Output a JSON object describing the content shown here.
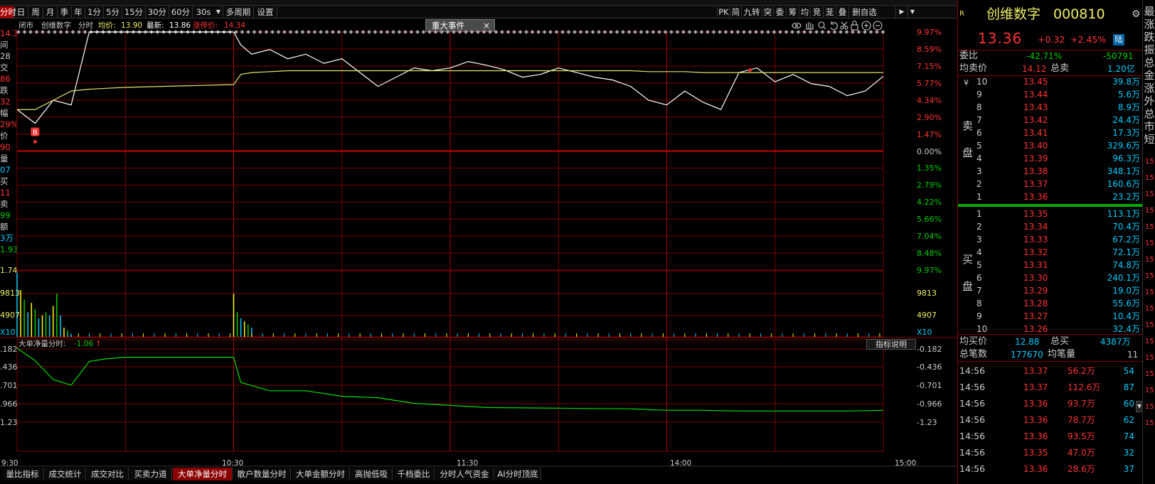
{
  "toolbar": {
    "tabs": [
      "分时",
      "日",
      "周",
      "月",
      "季",
      "年",
      "1分",
      "5分",
      "15分",
      "30分",
      "60分",
      "30s",
      "多周期",
      "设置"
    ],
    "dropdown_icon": "caret-down-icon",
    "right_tabs": [
      "PK",
      "简",
      "九转",
      "突",
      "委",
      "筹",
      "均",
      "竞",
      "茏",
      "叠",
      "删自选"
    ]
  },
  "header": {
    "status": "闭市",
    "stock_name": "创维数字",
    "mode": "分时",
    "avg_label": "均价:",
    "avg_value": "13.90",
    "latest_label": "最新:",
    "latest_value": "13.86",
    "limit_label": "涨停价:",
    "limit_value": "14.34",
    "event_button": "重大事件",
    "close_glyph": "×"
  },
  "tool_icons": [
    "eye-icon",
    "hand-icon",
    "zoom-icon",
    "undo-icon",
    "scissors-icon",
    "lock-icon",
    "zoom-in-icon",
    "zoom-out-icon"
  ],
  "left_panel": {
    "rows": [
      {
        "t": "14.34",
        "c": "#f33"
      },
      {
        "t": "间",
        "c": "#ccc"
      },
      {
        "t": "28",
        "c": "#ccc"
      },
      {
        "t": "交",
        "c": "#ccc"
      },
      {
        "t": "86",
        "c": "#f33"
      },
      {
        "t": "跌",
        "c": "#ccc"
      },
      {
        "t": "32",
        "c": "#f33"
      },
      {
        "t": "幅",
        "c": "#ccc"
      },
      {
        "t": "29%",
        "c": "#f33"
      },
      {
        "t": "价",
        "c": "#ccc"
      },
      {
        "t": "90",
        "c": "#f33"
      },
      {
        "t": "量",
        "c": "#ccc"
      },
      {
        "t": "07",
        "c": "#0cf"
      },
      {
        "t": "买",
        "c": "#ccc"
      },
      {
        "t": "11",
        "c": "#f33"
      },
      {
        "t": "卖",
        "c": "#ccc"
      },
      {
        "t": "99",
        "c": "#0c0"
      },
      {
        "t": "额",
        "c": "#ccc"
      },
      {
        "t": "3万",
        "c": "#0cf"
      },
      {
        "t": "1.93",
        "c": "#0c0"
      }
    ]
  },
  "price_axis": {
    "right_labels": [
      {
        "t": "9.97%",
        "c": "#f33"
      },
      {
        "t": "8.59%",
        "c": "#f33"
      },
      {
        "t": "7.15%",
        "c": "#f33"
      },
      {
        "t": "5.77%",
        "c": "#f33"
      },
      {
        "t": "4.34%",
        "c": "#f33"
      },
      {
        "t": "2.90%",
        "c": "#f33"
      },
      {
        "t": "1.47%",
        "c": "#f33"
      },
      {
        "t": "0.00%",
        "c": "#ccc"
      },
      {
        "t": "1.35%",
        "c": "#0c0"
      },
      {
        "t": "2.79%",
        "c": "#0c0"
      },
      {
        "t": "4.22%",
        "c": "#0c0"
      },
      {
        "t": "5.66%",
        "c": "#0c0"
      },
      {
        "t": "7.04%",
        "c": "#0c0"
      },
      {
        "t": "8.48%",
        "c": "#0c0"
      },
      {
        "t": "9.97%",
        "c": "#0c0"
      }
    ]
  },
  "volume_axis": {
    "labels": [
      "1.74",
      "9813",
      "4907",
      "X10"
    ],
    "right_labels": [
      "9813",
      "4907",
      "X10"
    ]
  },
  "indicator": {
    "title": "大单净量分时:",
    "value": "-1.06",
    "arrow": "↑",
    "help_button": "指标说明",
    "left_labels": [
      ".182",
      ".436",
      ".701",
      ".966",
      "1.23"
    ],
    "right_labels": [
      "-0.182",
      "-0.436",
      "-0.701",
      "-0.966",
      "-1.23"
    ]
  },
  "time_axis": [
    "9:30",
    "10:30",
    "11:30",
    "14:00",
    "15:00"
  ],
  "bottom_tabs": [
    "量比指标",
    "成交统计",
    "成交对比",
    "买卖力道",
    "大单净量分时",
    "散户数量分时",
    "大单金额分时",
    "高抛低吸",
    "千档委比",
    "分时人气资金",
    "AI分时顶底"
  ],
  "markers": {
    "buy": "B"
  },
  "colors": {
    "up": "#ff3232",
    "down": "#00cc00",
    "cyan": "#00ccff",
    "yellow": "#ffff00",
    "grid": "#7a0000",
    "price_line": "#ffffff",
    "avg_line": "#e6e66e",
    "net_line": "#00dd00"
  },
  "chart_data": [
    {
      "type": "line",
      "title": "",
      "x": [
        "9:30",
        "9:35",
        "9:40",
        "9:45",
        "9:50",
        "9:55",
        "10:00",
        "10:10",
        "10:20",
        "10:30",
        "10:32",
        "10:35",
        "10:40",
        "10:45",
        "10:50",
        "10:55",
        "11:00",
        "11:05",
        "11:10",
        "11:15",
        "11:20",
        "11:25",
        "11:30",
        "13:05",
        "13:10",
        "13:15",
        "13:20",
        "13:25",
        "13:30",
        "13:35",
        "13:40",
        "13:45",
        "13:50",
        "13:55",
        "14:00",
        "14:05",
        "14:10",
        "14:15",
        "14:20",
        "14:25",
        "14:30",
        "14:35",
        "14:40",
        "14:45",
        "14:50",
        "14:55",
        "15:00"
      ],
      "series": [
        {
          "name": "",
          "values": [
            13.5,
            13.35,
            13.6,
            13.55,
            14.34,
            14.34,
            14.34,
            14.34,
            14.34,
            14.34,
            14.2,
            14.1,
            14.15,
            14.05,
            14.1,
            14.0,
            14.05,
            13.9,
            13.75,
            13.85,
            13.95,
            13.92,
            13.95,
            14.02,
            13.98,
            13.93,
            13.85,
            13.88,
            13.95,
            13.9,
            13.85,
            13.82,
            13.75,
            13.6,
            13.55,
            13.7,
            13.58,
            13.5,
            13.9,
            13.95,
            13.8,
            13.88,
            13.78,
            13.75,
            13.65,
            13.7,
            13.86
          ]
        },
        {
          "name": "",
          "values": [
            13.5,
            13.5,
            13.6,
            13.7,
            13.72,
            13.73,
            13.74,
            13.75,
            13.76,
            13.77,
            13.88,
            13.9,
            13.91,
            13.92,
            13.92,
            13.92,
            13.92,
            13.92,
            13.92,
            13.92,
            13.92,
            13.92,
            13.92,
            13.92,
            13.92,
            13.92,
            13.92,
            13.92,
            13.92,
            13.92,
            13.92,
            13.92,
            13.92,
            13.91,
            13.91,
            13.91,
            13.9,
            13.9,
            13.9,
            13.9,
            13.9,
            13.9,
            13.9,
            13.9,
            13.9,
            13.9,
            13.9
          ]
        }
      ],
      "y_axis": {
        "type": "percent_change",
        "ylim": [
          -9.97,
          9.97
        ],
        "ticks": [
          "9.97%",
          "8.59%",
          "7.15%",
          "5.77%",
          "4.34%",
          "2.90%",
          "1.47%",
          "0.00%",
          "1.35%",
          "2.79%",
          "4.22%",
          "5.66%",
          "7.04%",
          "8.48%",
          "9.97%"
        ]
      },
      "grid": true
    },
    {
      "type": "bar",
      "title": "",
      "x": [
        "9:30",
        "9:31",
        "9:32",
        "9:33",
        "9:34",
        "9:35",
        "9:36",
        "9:37",
        "9:38",
        "9:39",
        "9:40",
        "9:41",
        "9:42",
        "9:43",
        "9:44",
        "9:45",
        "10:30",
        "10:31",
        "10:32",
        "10:33",
        "10:34",
        "10:35"
      ],
      "series": [
        {
          "name": "",
          "values": [
            14500,
            10600,
            8400,
            5600,
            7700,
            6300,
            4200,
            4900,
            5600,
            4900,
            7000,
            9800,
            4900,
            2100,
            1400,
            700,
            9800,
            5600,
            4200,
            3500,
            2800,
            2100
          ]
        }
      ],
      "y_axis": {
        "unit": "X10",
        "ticks": [
          "9813",
          "4907"
        ]
      },
      "grid": true
    },
    {
      "type": "line",
      "title": "大单净量分时",
      "x": [
        "9:30",
        "9:35",
        "9:40",
        "9:45",
        "9:50",
        "9:55",
        "10:00",
        "10:10",
        "10:20",
        "10:30",
        "10:32",
        "10:40",
        "10:50",
        "11:00",
        "11:10",
        "11:20",
        "11:30",
        "13:10",
        "13:30",
        "13:50",
        "14:00",
        "14:10",
        "14:20",
        "14:30",
        "14:40",
        "14:50",
        "15:00"
      ],
      "series": [
        {
          "name": "大单净量分时",
          "values": [
            -0.17,
            -0.35,
            -0.62,
            -0.7,
            -0.36,
            -0.32,
            -0.3,
            -0.3,
            -0.3,
            -0.3,
            -0.66,
            -0.78,
            -0.78,
            -0.86,
            -0.88,
            -0.96,
            -0.99,
            -1.02,
            -1.03,
            -1.04,
            -1.06,
            -1.06,
            -1.07,
            -1.07,
            -1.07,
            -1.07,
            -1.06
          ]
        }
      ],
      "y_axis": {
        "ticks": [
          "-0.182",
          "-0.436",
          "-0.701",
          "-0.966",
          "-1.23"
        ]
      },
      "grid": true
    }
  ],
  "quote": {
    "r_badge": "R",
    "name": "创维数字",
    "code": "000810",
    "price": "13.36",
    "change": "+0.32",
    "pct": "+2.45%",
    "lu_badge": "陆",
    "wb_label": "委比",
    "wb_pct": "-42.71%",
    "wb_diff": "-50791",
    "avg_sell_label": "均卖价",
    "avg_sell": "14.12",
    "total_sell_label": "总卖",
    "total_sell": "1.20亿",
    "sell_label": [
      "卖",
      "盘"
    ],
    "buy_label": [
      "买",
      "盘"
    ],
    "yen_glyph": "¥",
    "asks": [
      {
        "lvl": "10",
        "price": "13.45",
        "vol": "39.8万"
      },
      {
        "lvl": "9",
        "price": "13.44",
        "vol": "5.6万"
      },
      {
        "lvl": "8",
        "price": "13.43",
        "vol": "8.9万"
      },
      {
        "lvl": "7",
        "price": "13.42",
        "vol": "24.4万"
      },
      {
        "lvl": "6",
        "price": "13.41",
        "vol": "17.3万"
      },
      {
        "lvl": "5",
        "price": "13.40",
        "vol": "329.6万"
      },
      {
        "lvl": "4",
        "price": "13.39",
        "vol": "96.3万"
      },
      {
        "lvl": "3",
        "price": "13.38",
        "vol": "348.1万"
      },
      {
        "lvl": "2",
        "price": "13.37",
        "vol": "160.6万"
      },
      {
        "lvl": "1",
        "price": "13.36",
        "vol": "23.2万"
      }
    ],
    "bids": [
      {
        "lvl": "1",
        "price": "13.35",
        "vol": "113.1万"
      },
      {
        "lvl": "2",
        "price": "13.34",
        "vol": "70.4万"
      },
      {
        "lvl": "3",
        "price": "13.33",
        "vol": "67.2万"
      },
      {
        "lvl": "4",
        "price": "13.32",
        "vol": "72.1万"
      },
      {
        "lvl": "5",
        "price": "13.31",
        "vol": "74.8万"
      },
      {
        "lvl": "6",
        "price": "13.30",
        "vol": "240.1万"
      },
      {
        "lvl": "7",
        "price": "13.29",
        "vol": "19.0万"
      },
      {
        "lvl": "8",
        "price": "13.28",
        "vol": "55.6万"
      },
      {
        "lvl": "9",
        "price": "13.27",
        "vol": "10.4万"
      },
      {
        "lvl": "10",
        "price": "13.26",
        "vol": "32.4万"
      }
    ],
    "avg_buy_label": "均买价",
    "avg_buy": "12.88",
    "total_buy_label": "总买",
    "total_buy": "4387万",
    "trades_label": "总笔数",
    "trades": "177670",
    "avg_trade_label": "均笔量",
    "avg_trade": "11",
    "ticks": [
      {
        "time": "14:56",
        "price": "13.37",
        "amt": "56.2万",
        "n": "54"
      },
      {
        "time": "14:56",
        "price": "13.37",
        "amt": "112.6万",
        "n": "87"
      },
      {
        "time": "14:56",
        "price": "13.36",
        "amt": "93.7万",
        "n": "60"
      },
      {
        "time": "14:56",
        "price": "13.36",
        "amt": "78.7万",
        "n": "62"
      },
      {
        "time": "14:56",
        "price": "13.36",
        "amt": "93.5万",
        "n": "74"
      },
      {
        "time": "14:56",
        "price": "13.35",
        "amt": "47.0万",
        "n": "32"
      },
      {
        "time": "14:56",
        "price": "13.36",
        "amt": "28.6万",
        "n": "37"
      }
    ]
  },
  "side_tabs": [
    "最",
    "涨",
    "跌",
    "振",
    "总",
    "金",
    "涨",
    "外",
    "总",
    "市",
    "短"
  ],
  "side_numbers": [
    "15",
    "15",
    "15",
    "15",
    "15",
    "15",
    "15",
    "15",
    "15",
    "15",
    "15",
    "15",
    "15",
    "15",
    "15",
    "15",
    "15"
  ]
}
